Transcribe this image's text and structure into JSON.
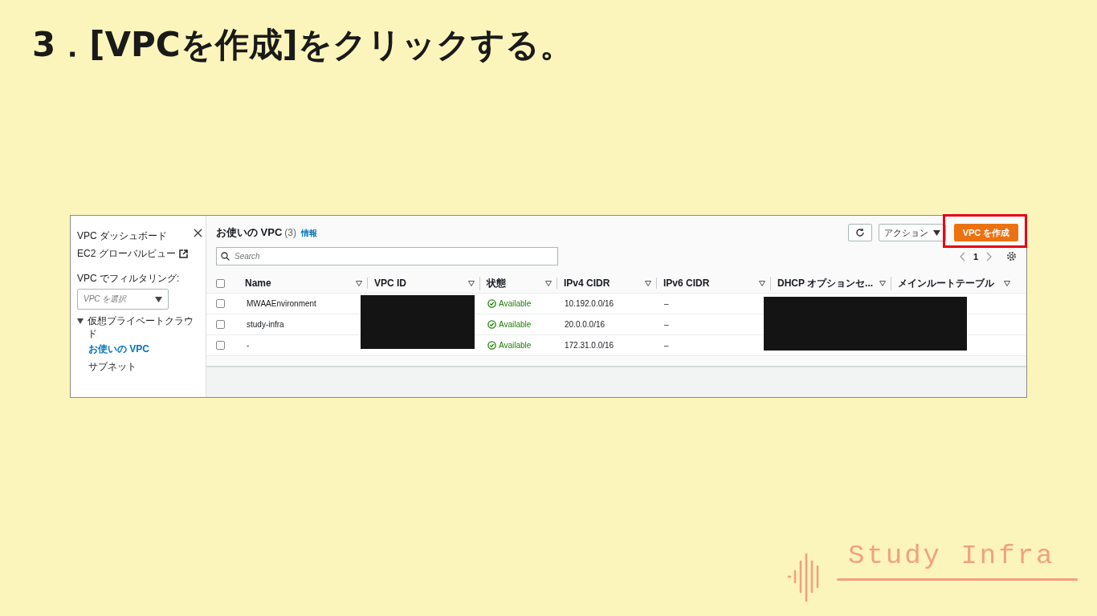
{
  "slide_title": "3．[VPCを作成]をクリックする。",
  "sidebar": {
    "links": [
      {
        "label": "VPC ダッシュボード",
        "kind": "plain"
      },
      {
        "label": "EC2 グローバルビュー",
        "kind": "external"
      }
    ],
    "filter_label": "VPC でフィルタリング:",
    "filter_select": {
      "placeholder": "VPC を選択"
    },
    "section": {
      "label": "仮想プライベートクラウド",
      "expanded": true,
      "items": [
        {
          "label": "お使いの VPC",
          "selected": true
        },
        {
          "label": "サブネット",
          "selected": false
        }
      ]
    }
  },
  "main": {
    "title": "お使いの VPC",
    "count": "(3)",
    "info_link": "情報",
    "actions_button": "アクション",
    "create_button": {
      "label": "VPC を作成",
      "highlighted": true
    },
    "search": {
      "placeholder": "Search"
    },
    "page": "1",
    "all_selected": false,
    "columns": [
      "Name",
      "VPC ID",
      "状態",
      "IPv4 CIDR",
      "IPv6 CIDR",
      "DHCP オプションセ...",
      "メインルートテーブル"
    ],
    "rows": [
      {
        "selected": false,
        "name": "MWAAEnvironment",
        "status": "Available",
        "ipv4": "10.192.0.0/16",
        "ipv6": "–"
      },
      {
        "selected": false,
        "name": "study-infra",
        "status": "Available",
        "ipv4": "20.0.0.0/16",
        "ipv6": "–"
      },
      {
        "selected": false,
        "name": "-",
        "status": "Available",
        "ipv4": "172.31.0.0/16",
        "ipv6": "–"
      }
    ]
  },
  "logo": {
    "text": "Study Infra"
  }
}
